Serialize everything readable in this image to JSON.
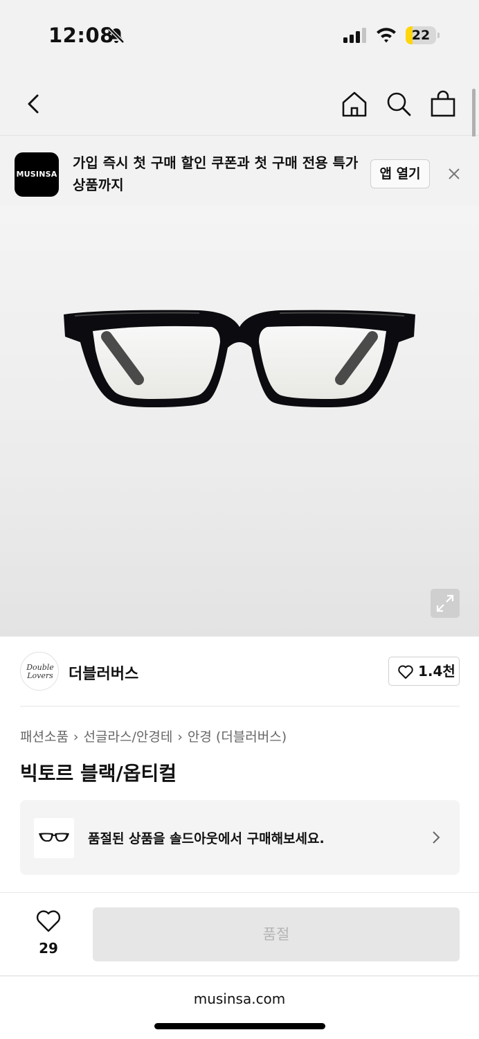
{
  "status_bar": {
    "time": "12:08",
    "battery_level": 22,
    "battery_label": "22",
    "icons": [
      "bell-muted-icon",
      "cellular-signal-icon",
      "wifi-icon",
      "battery-icon"
    ]
  },
  "nav": {
    "icons": [
      "back-chevron-icon",
      "home-icon",
      "search-icon",
      "shopping-bag-icon"
    ]
  },
  "app_banner": {
    "logo_text": "MUSINSA",
    "message": "가입 즉시 첫 구매 할인 쿠폰과 첫 구매 전용 특가 상품까지",
    "open_button": "앱 열기",
    "close_icon": "close-icon"
  },
  "product_image": {
    "icon": "expand-icon"
  },
  "brand": {
    "logo_line1": "Double",
    "logo_line2": "Lovers",
    "name": "더블러버스",
    "like_count": "1.4천"
  },
  "breadcrumb": [
    "패션소품",
    "선글라스/안경테",
    "안경 (더블러버스)"
  ],
  "product": {
    "title": "빅토르 블랙/옵티컬"
  },
  "soldout_banner": {
    "text": "품절된 상품을 솔드아웃에서 구매해보세요."
  },
  "bottom_bar": {
    "wish_count": "29",
    "button_label": "품절"
  },
  "browser": {
    "url": "musinsa.com"
  },
  "colors": {
    "background": "#f2f2f2",
    "battery_fill": "#ffd60a",
    "disabled_button": "#e6e6e6",
    "disabled_text": "#b4b4b4"
  }
}
